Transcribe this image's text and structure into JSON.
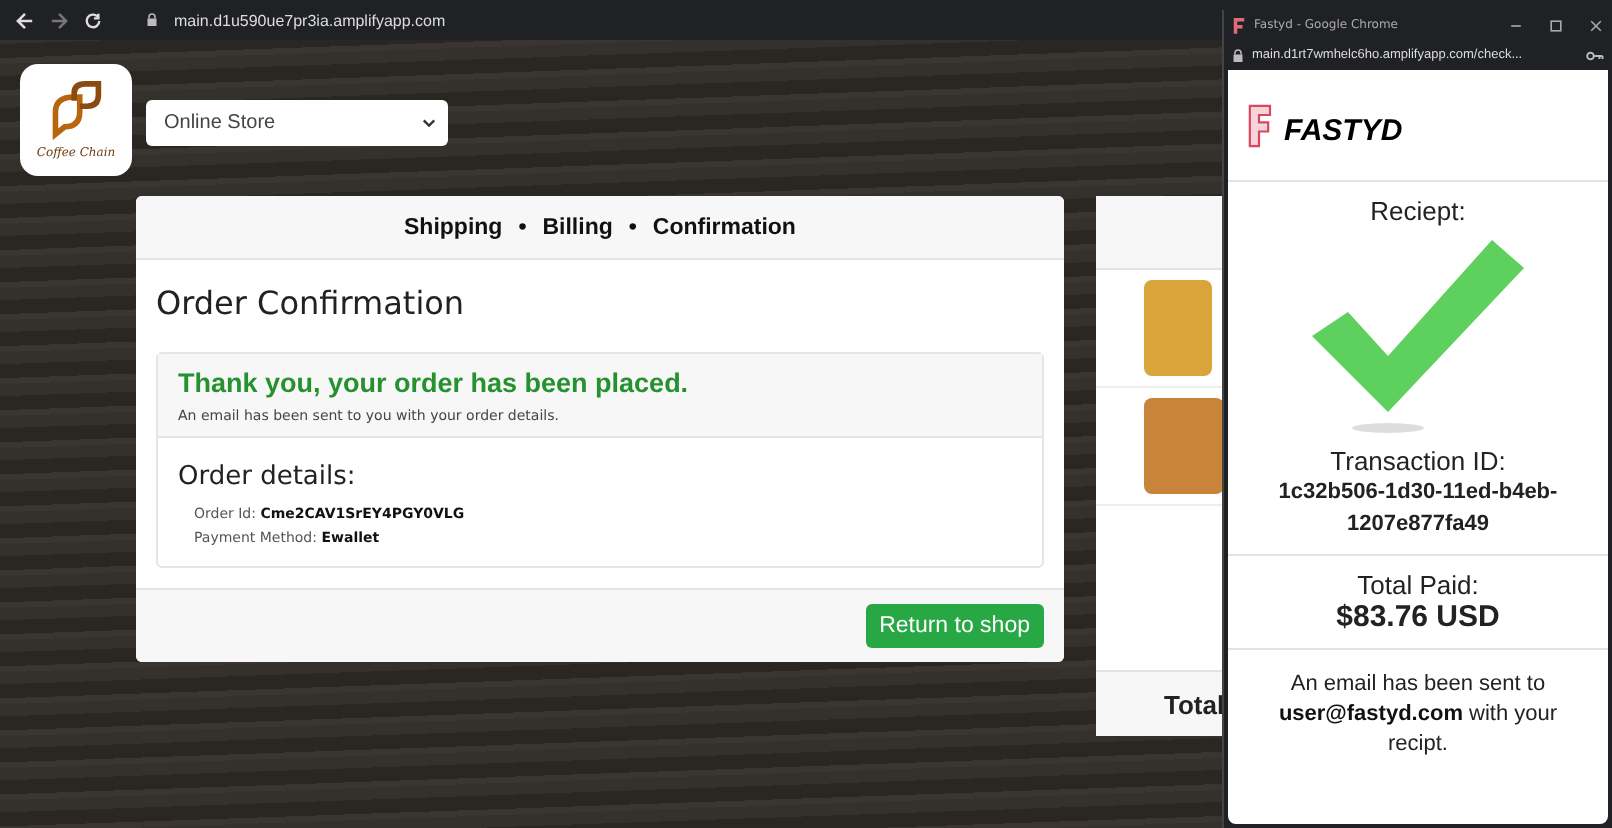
{
  "browser": {
    "url": "main.d1u590ue7pr3ia.amplifyapp.com"
  },
  "header": {
    "logo_text": "Coffee Chain",
    "store_select": "Online Store"
  },
  "checkout": {
    "steps": [
      {
        "label": "Shipping"
      },
      {
        "label": "Billing"
      },
      {
        "label": "Confirmation"
      }
    ],
    "separator": "•",
    "title": "Order Confirmation",
    "success": {
      "heading": "Thank you, your order has been placed.",
      "note": "An email has been sent to you with your order details."
    },
    "details": {
      "heading": "Order details:",
      "lines": [
        "Order Id: **Cme2CAV1SrEY4PGY0VLG**",
        "Payment Method: **Ewallet**"
      ]
    },
    "button": "Return to shop"
  },
  "cart": {
    "total_label": "Total"
  },
  "popup": {
    "window_title": "Fastyd - Google Chrome",
    "url": "main.d1rt7wmhelc6ho.amplifyapp.com/check...",
    "brand": "FASTYD",
    "receipt_label": "Reciept:",
    "transaction_label": "Transaction ID:",
    "transaction_id": "1c32b506-1d30-11ed-b4eb-1207e877fa49",
    "total_label": "Total Paid:",
    "total": "$83.76 USD",
    "email_note": "An email has been sent to **user@fastyd.com** with your recipt."
  }
}
